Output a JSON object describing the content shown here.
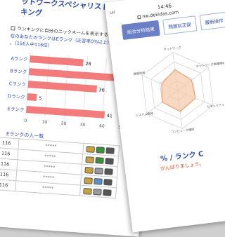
{
  "left_page": {
    "title": "ットワークスペシャリスト 合格教本 ンキング",
    "checkbox_label": "ランキングに自分のニックネームを表示する",
    "rank_note_line1": "在のあなたのランクはEランク（正答率0%以上）で",
    "rank_note_line2": "。（156人中116位）",
    "chart_data": {
      "type": "bar",
      "categories": [
        "Aランク",
        "Bランク",
        "Cランク",
        "Dランク",
        "Eランク"
      ],
      "values": [
        28,
        46,
        36,
        5,
        41
      ],
      "xlim": [
        0,
        50
      ],
      "xticks": [
        "0",
        "10",
        "20",
        "30",
        "40",
        "50"
      ],
      "bar_color": "#f27c7c",
      "grid": true
    },
    "table_title": "Eランクの人一覧",
    "table_rows": [
      {
        "num": "116",
        "name": "*****",
        "badges": [
          "#c9a23a",
          "#3a8f3a",
          "#555555"
        ]
      },
      {
        "num": "116",
        "name": "*****",
        "badges": [
          "#c9a23a",
          "#3a8f3a",
          "#555555"
        ]
      },
      {
        "num": "116",
        "name": "*****",
        "badges": [
          "#c9a23a",
          "#999999",
          "#555555"
        ]
      },
      {
        "num": "116",
        "name": "*****",
        "badges": [
          "#c9a23a",
          "#5a8fc9",
          "#555555"
        ]
      },
      {
        "num": "116",
        "name": "*****",
        "badges": [
          "#c9a23a",
          "#999999",
          "#555555"
        ]
      }
    ]
  },
  "right_page": {
    "signal": "ull",
    "time": "14:46",
    "url": "nw.dekidas.com",
    "tabs": [
      "総合分析結果",
      "問題別正誤",
      "最新操作"
    ],
    "radar": {
      "labels": [
        "ネットワーク",
        "ネットワーク関連情報",
        "セキュリティ",
        "コンピュータ構成",
        "システム開発",
        "開発技術"
      ],
      "values": [
        0.55,
        0.45,
        0.5,
        0.55,
        0.5,
        0.45
      ],
      "fill_color": "#f7c7a8",
      "stroke_color": "#e89a6a"
    },
    "rank_text": "% / ランク C",
    "cheer_text": "がんばりましょう。"
  }
}
